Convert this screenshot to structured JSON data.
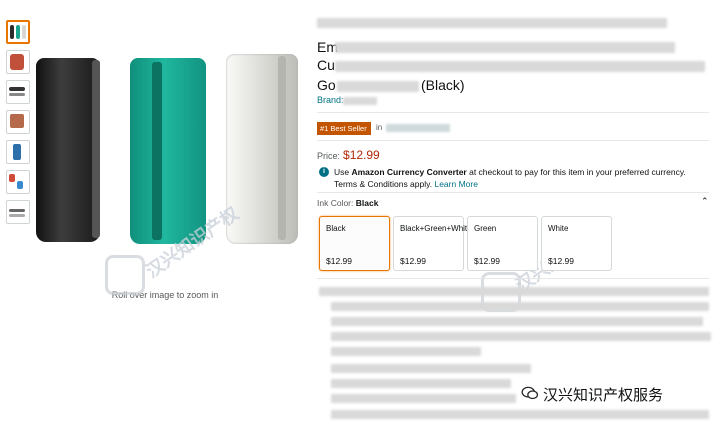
{
  "gallery": {
    "thumbnail_count": 7,
    "zoom_hint": "Roll over image to zoom in",
    "product_colors": [
      "#2b2b2b",
      "#1aa58f",
      "#e8e8e4"
    ]
  },
  "product": {
    "title_line1_start": "Em",
    "title_line2_start": "Cu",
    "title_line3_start": "Go",
    "title_line3_end": "(Black)",
    "brand_prefix": "Brand:",
    "badge": "#1 Best Seller",
    "badge_in": "in",
    "price_label": "Price:",
    "price": "$12.99"
  },
  "currency_notice": {
    "text_before": "Use ",
    "bold": "Amazon Currency Converter",
    "text_after": " at checkout to pay for this item in your preferred currency. Terms & Conditions apply. ",
    "link": "Learn More"
  },
  "ink_color": {
    "label": "Ink Color:",
    "selected": "Black",
    "options": [
      {
        "name": "Black",
        "price": "$12.99"
      },
      {
        "name": "Black+Green+White",
        "price": "$12.99"
      },
      {
        "name": "Green",
        "price": "$12.99"
      },
      {
        "name": "White",
        "price": "$12.99"
      }
    ]
  },
  "watermark": {
    "text": "汉兴知识产权",
    "footer": "汉兴知识产权服务"
  },
  "colors": {
    "accent_orange": "#e77600",
    "badge_bg": "#c45500",
    "price_red": "#b12704",
    "link_teal": "#007185"
  }
}
